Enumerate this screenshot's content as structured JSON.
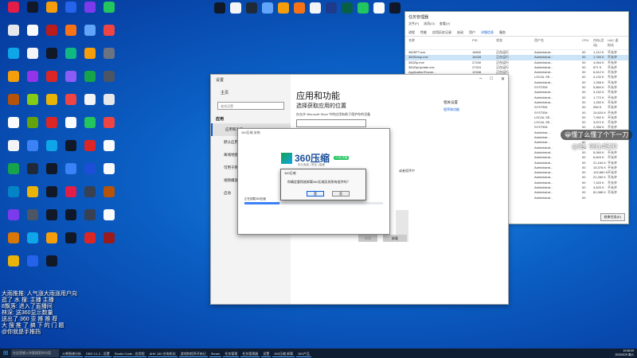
{
  "desktop": {
    "icons": [
      {
        "label": "",
        "color": "#e11d48"
      },
      {
        "label": "",
        "color": "#111827"
      },
      {
        "label": "",
        "color": "#f59e0b"
      },
      {
        "label": "",
        "color": "#2563eb"
      },
      {
        "label": "",
        "color": "#7c3aed"
      },
      {
        "label": "",
        "color": "#22c55e"
      },
      {
        "label": "",
        "color": "#e5e7eb"
      },
      {
        "label": "",
        "color": "#f9fafb"
      },
      {
        "label": "",
        "color": "#b91c1c"
      },
      {
        "label": "",
        "color": "#f97316"
      },
      {
        "label": "",
        "color": "#60a5fa"
      },
      {
        "label": "",
        "color": "#ef4444"
      },
      {
        "label": "",
        "color": "#0ea5e9"
      },
      {
        "label": "",
        "color": "#f3f4f6"
      },
      {
        "label": "",
        "color": "#111827"
      },
      {
        "label": "",
        "color": "#10b981"
      },
      {
        "label": "",
        "color": "#f59e0b"
      },
      {
        "label": "",
        "color": "#6b7280"
      },
      {
        "label": "",
        "color": "#f59e0b"
      },
      {
        "label": "",
        "color": "#9333ea"
      },
      {
        "label": "",
        "color": "#dc2626"
      },
      {
        "label": "",
        "color": "#8b5cf6"
      },
      {
        "label": "",
        "color": "#16a34a"
      },
      {
        "label": "",
        "color": "#4b5563"
      },
      {
        "label": "",
        "color": "#b45309"
      },
      {
        "label": "",
        "color": "#84cc16"
      },
      {
        "label": "",
        "color": "#eab308"
      },
      {
        "label": "",
        "color": "#ef4444"
      },
      {
        "label": "",
        "color": "#f3f4f6"
      },
      {
        "label": "",
        "color": "#e5e7eb"
      },
      {
        "label": "",
        "color": "#f9fafb"
      },
      {
        "label": "",
        "color": "#65a30d"
      },
      {
        "label": "",
        "color": "#dc2626"
      },
      {
        "label": "",
        "color": "#f9fafb"
      },
      {
        "label": "",
        "color": "#22c55e"
      },
      {
        "label": "",
        "color": "#ef4444"
      },
      {
        "label": "",
        "color": "#f3f4f6"
      },
      {
        "label": "",
        "color": "#3b82f6"
      },
      {
        "label": "",
        "color": "#0ea5e9"
      },
      {
        "label": "",
        "color": "#111827"
      },
      {
        "label": "",
        "color": "#dc2626"
      },
      {
        "label": "",
        "color": "#f9fafb"
      },
      {
        "label": "",
        "color": "#16a34a"
      },
      {
        "label": "",
        "color": "#1f2937"
      },
      {
        "label": "",
        "color": "#111827"
      },
      {
        "label": "",
        "color": "#3b82f6"
      },
      {
        "label": "",
        "color": "#1d4ed8"
      },
      {
        "label": "",
        "color": "#f9fafb"
      },
      {
        "label": "",
        "color": "#0284c7"
      },
      {
        "label": "",
        "color": "#eab308"
      },
      {
        "label": "",
        "color": "#111827"
      },
      {
        "label": "",
        "color": "#e11d48"
      },
      {
        "label": "",
        "color": "#374151"
      },
      {
        "label": "",
        "color": "#b45309"
      },
      {
        "label": "",
        "color": "#7c3aed"
      },
      {
        "label": "",
        "color": "#4b5563"
      },
      {
        "label": "",
        "color": "#111827"
      },
      {
        "label": "",
        "color": "#0f172a"
      },
      {
        "label": "",
        "color": "#374151"
      },
      {
        "label": "",
        "color": "#f9fafb"
      },
      {
        "label": "",
        "color": "#d97706"
      },
      {
        "label": "",
        "color": "#0ea5e9"
      },
      {
        "label": "",
        "color": "#f59e0b"
      },
      {
        "label": "",
        "color": "#111827"
      },
      {
        "label": "",
        "color": "#dc2626"
      },
      {
        "label": "",
        "color": "#991b1b"
      },
      {
        "label": "",
        "color": "#eab308"
      },
      {
        "label": "",
        "color": "#2563eb"
      },
      {
        "label": "",
        "color": "#111827"
      }
    ],
    "top_icons": [
      {
        "color": "#111827"
      },
      {
        "color": "#f3f4f6"
      },
      {
        "color": "#1f2937"
      },
      {
        "color": "#60a5fa"
      },
      {
        "color": "#f59e0b"
      },
      {
        "color": "#f97316"
      },
      {
        "color": "#f3f4f6"
      },
      {
        "color": "#1e3a8a"
      },
      {
        "color": "#065f46"
      },
      {
        "color": "#22c55e"
      },
      {
        "color": "#f9fafb"
      },
      {
        "color": "#0f172a"
      }
    ]
  },
  "task_manager": {
    "title": "任务管理器",
    "menu": [
      "文件(F)",
      "选项(O)",
      "查看(V)"
    ],
    "tabs": [
      "进程",
      "性能",
      "应用历史记录",
      "启动",
      "用户",
      "详细信息",
      "服务"
    ],
    "active_tab": "详细信息",
    "columns": [
      "名称",
      "PID",
      "状态",
      "用户名",
      "CPU",
      "内存(活动)",
      "UAC 虚拟化",
      ""
    ],
    "rows": [
      [
        "360SFT.exe",
        "16840",
        "正在运行",
        "Administrat...",
        "00",
        "1,112 K",
        "不允许",
        ""
      ],
      [
        "360Setup.exe",
        "16428",
        "正在运行",
        "Administrat...",
        "00",
        "1,760 K",
        "不允许",
        ""
      ],
      [
        "360Zip.exe",
        "27240",
        "正在运行",
        "Administrat...",
        "00",
        "4,064 K",
        "不允许",
        ""
      ],
      [
        "360ZipUpdate.exe",
        "27424",
        "正在运行",
        "Administrat...",
        "00",
        "871 K",
        "不允许",
        ""
      ],
      [
        "ApplicationFrame...",
        "10348",
        "正在运行",
        "Administrat...",
        "00",
        "6,612 K",
        "不允许",
        ""
      ],
      [
        "audiodg.exe",
        "11152",
        "正在运行",
        "LOCAL SE...",
        "00",
        "4,132 K",
        "不允许",
        ""
      ],
      [
        "ChsIME.exe",
        "13084",
        "正在运行",
        "Administrat...",
        "00",
        "1,268 K",
        "不允许",
        ""
      ],
      [
        "csrss.exe",
        "",
        "",
        "SYSTEM",
        "00",
        "5,884 K",
        "不允许",
        ""
      ],
      [
        "",
        "",
        "",
        "Administrat...",
        "00",
        "3,152 K",
        "不允许",
        ""
      ],
      [
        "",
        "",
        "",
        "Administrat...",
        "00",
        "1,772 K",
        "不允许",
        ""
      ],
      [
        "",
        "",
        "",
        "Administrat...",
        "00",
        "1,260 K",
        "不允许",
        ""
      ],
      [
        "",
        "",
        "",
        "SYSTEM",
        "00",
        "956 K",
        "不允许",
        ""
      ],
      [
        "",
        "",
        "",
        "SYSTEM",
        "00",
        "24,624 K",
        "不允许",
        ""
      ],
      [
        "",
        "",
        "",
        "LOCAL SE...",
        "00",
        "7,992 K",
        "不允许",
        ""
      ],
      [
        "",
        "",
        "",
        "LOCAL SE...",
        "00",
        "3,672 K",
        "不允许",
        ""
      ],
      [
        "",
        "",
        "",
        "SYSTEM",
        "00",
        "2,356 K",
        "不允许",
        ""
      ],
      [
        "",
        "",
        "",
        "Administr...",
        "00",
        "",
        "",
        ""
      ],
      [
        "",
        "",
        "",
        "Administr...",
        "00",
        "",
        "",
        ""
      ],
      [
        "",
        "",
        "",
        "Administr...",
        "00",
        "",
        "",
        ""
      ],
      [
        "",
        "",
        "",
        "Administrat...",
        "00",
        "",
        "",
        ""
      ],
      [
        "",
        "",
        "",
        "Administrat...",
        "00",
        "5,060 K",
        "不允许",
        ""
      ],
      [
        "",
        "",
        "",
        "Administrat...",
        "00",
        "6,604 K",
        "不允许",
        ""
      ],
      [
        "",
        "",
        "",
        "Administrat...",
        "00",
        "21,164 K",
        "不允许",
        ""
      ],
      [
        "",
        "",
        "",
        "Administrat...",
        "00",
        "15,376 K",
        "不允许",
        ""
      ],
      [
        "",
        "",
        "",
        "Administrat...",
        "00",
        "102,860 K",
        "不允许",
        ""
      ],
      [
        "",
        "",
        "",
        "Administrat...",
        "00",
        "21,260 K",
        "不允许",
        ""
      ],
      [
        "",
        "",
        "",
        "Administrat...",
        "00",
        "7,420 K",
        "不允许",
        ""
      ],
      [
        "",
        "",
        "",
        "Administrat...",
        "00",
        "3,820 K",
        "不允许",
        ""
      ],
      [
        "",
        "",
        "",
        "Administrat...",
        "00",
        "81,988 K",
        "不允许",
        ""
      ],
      [
        "LMRS-0...",
        "",
        "",
        "Administrat...",
        "00",
        "",
        "",
        ""
      ]
    ],
    "less_details": "简略信息(D)",
    "end_task": "结束任务(E)"
  },
  "settings": {
    "window_title": "设置",
    "home": "主页",
    "search_placeholder": "查找设置",
    "group": "应用",
    "nav": [
      "应用和功能",
      "默认应用",
      "离线地图",
      "可用于网站的应用",
      "视频播放",
      "启动"
    ],
    "heading": "应用和功能",
    "subheading": "选择获取应用的位置",
    "desc": "仅允许 Microsoft Store 中的应用有助于保护你的设备",
    "dropdown": "",
    "related": "相关设置",
    "related_link": "程序和功能",
    "side_text": "或者程序中",
    "btn_modify": "修改",
    "btn_uninstall": "卸载"
  },
  "installer": {
    "title": "360压缩 安装",
    "logo_text": "360压缩",
    "version_badge": "4.0正式版",
    "sub": "永久免费 | 安全 | 高速",
    "status": "正在卸载360压缩",
    "progress": 0.25
  },
  "dialog": {
    "title": "360压缩",
    "message": "你确定要彻底卸载360压缩及其所有组件吗？",
    "yes": "是",
    "no": "否"
  },
  "overlay": {
    "pill": "😀懂了么懂了个下一刀",
    "id_text": "◎ID: 9614520"
  },
  "chat": [
    "大雨推推: 人气涨大雨涨用户向",
    "逛了 水 搜: 主播 主播",
    "8飘落: 进入了直播间",
    "林深: 送360显示数量",
    "送出了 360 亚 推 推 荐",
    "大 搜 推 了 搞 下 的 门 题",
    "@你就是手推挡"
  ],
  "taskbar": {
    "search": "在这里输入你要搜索的内容",
    "items": [
      "火柴图谱分析",
      "DBS 3.1.2 - 设置",
      "Studio Crate - 应用程",
      "AHK 180 台电机化",
      "游戏和程序开始记",
      "Steam",
      "任务管理",
      "任务管理器",
      "设置",
      "360压缩 卸载",
      "360产品"
    ],
    "time": "10:08:09",
    "date": "2023/5/25 周六"
  }
}
